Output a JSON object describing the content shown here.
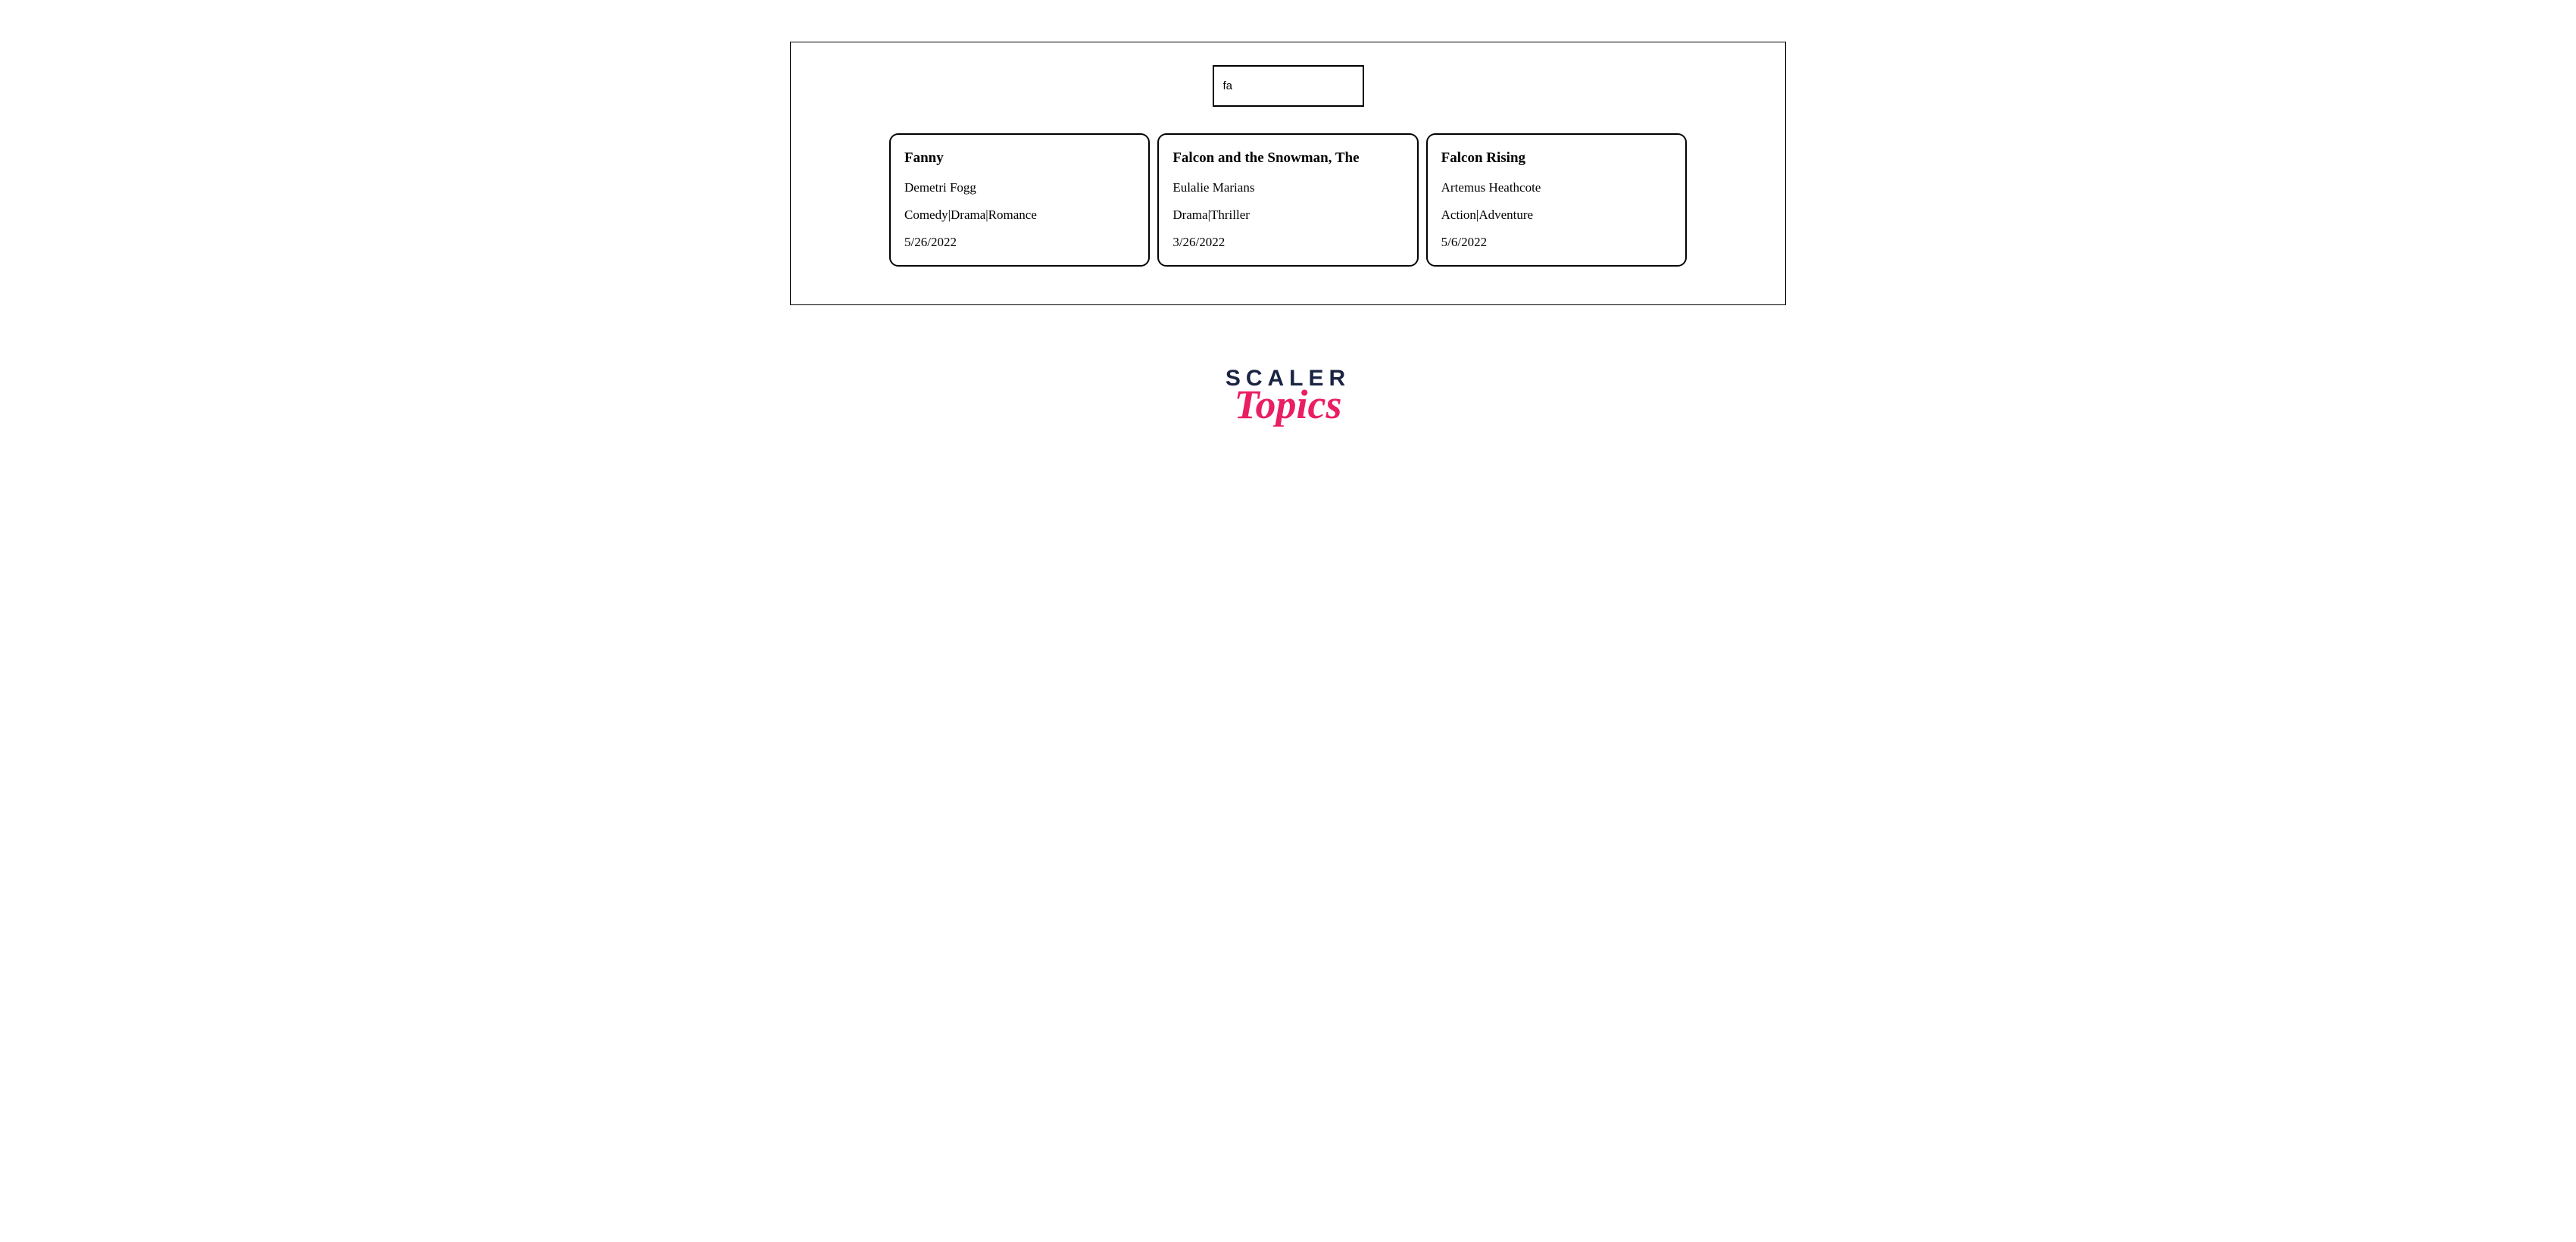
{
  "search": {
    "value": "fa"
  },
  "cards": [
    {
      "title": "Fanny",
      "author": "Demetri Fogg",
      "genres": "Comedy|Drama|Romance",
      "date": "5/26/2022"
    },
    {
      "title": "Falcon and the Snowman, The",
      "author": "Eulalie Marians",
      "genres": "Drama|Thriller",
      "date": "3/26/2022"
    },
    {
      "title": "Falcon Rising",
      "author": "Artemus Heathcote",
      "genres": "Action|Adventure",
      "date": "5/6/2022"
    }
  ],
  "logo": {
    "line1": "SCALER",
    "line2": "Topics"
  }
}
